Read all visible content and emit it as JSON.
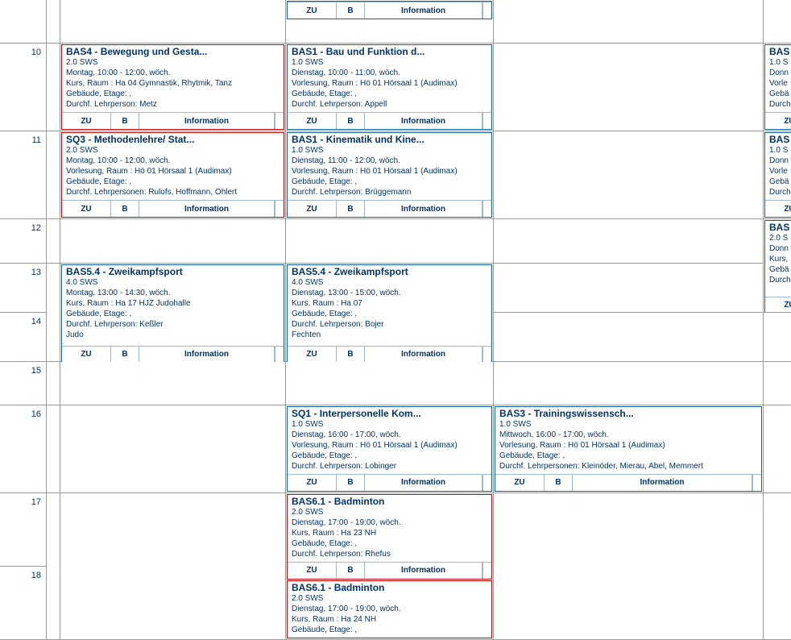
{
  "buttons": {
    "zu": "ZU",
    "b": "B",
    "info": "Information"
  },
  "hours": {
    "r9": "",
    "r10": "10",
    "r11": "11",
    "r12": "12",
    "r13": "13",
    "r14": "14",
    "r15": "15",
    "r16": "16",
    "r17": "17",
    "r18": "18"
  },
  "c_top_tue": {
    "has_header": false
  },
  "c10_mon": {
    "code": "BAS4",
    "title": "Bewegung und Gesta...",
    "sws": "2.0 SWS",
    "time": "Montag,  10:00 - 12:00, wöch.",
    "room": "Kurs, Raum : Ha 04 Gymnastik, Rhytmik, Tanz",
    "geb": "Gebäude, Etage: ,",
    "pers": "Durchf. Lehrperson: Metz",
    "red": true
  },
  "c10_tue": {
    "code": "BAS1",
    "title": "Bau und Funktion d...",
    "sws": "1.0 SWS",
    "time": "Dienstag,  10:00 - 11:00, wöch.",
    "room": "Vorlesung, Raum : Hö 01 Hörsaal 1 (Audimax)",
    "geb": "Gebäude, Etage: ,",
    "pers": "Durchf. Lehrperson: Appell",
    "red": false
  },
  "c10_thu": {
    "code": "BAS",
    "sws": "1.0 S",
    "time": "Donn",
    "room": "Vorle",
    "geb": "Gebä",
    "pers": "Durch",
    "red": false
  },
  "c11_mon": {
    "code": "SQ3",
    "title": "Methodenlehre/ Stat...",
    "sws": "2.0 SWS",
    "time": "Montag,  10:00 - 12:00, wöch.",
    "room": "Vorlesung, Raum : Hö 01 Hörsaal 1 (Audimax)",
    "geb": "Gebäude, Etage: ,",
    "pers": "Durchf. Lehrpersonen: Rulofs,  Hoffmann,  Ohlert",
    "red": true
  },
  "c11_tue": {
    "code": "BAS1",
    "title": "Kinematik und Kine...",
    "sws": "1.0 SWS",
    "time": "Dienstag,  11:00 - 12:00, wöch.",
    "room": "Vorlesung, Raum : Hö 01 Hörsaal 1 (Audimax)",
    "geb": "Gebäude, Etage: ,",
    "pers": "Durchf. Lehrperson: Brüggemann",
    "red": false
  },
  "c11_thu": {
    "code": "BAS",
    "sws": "1.0 S",
    "time": "Donn",
    "room": "Vorle",
    "geb": "Gebä",
    "pers": "Durch",
    "red": false
  },
  "c12_thu": {
    "code": "BAS",
    "sws": "2.0 S",
    "time": "Donn",
    "room": "Kurs,",
    "geb": "Gebä",
    "pers": "Durch",
    "red": false
  },
  "c13_mon": {
    "code": "BAS5.4",
    "title": "Zweikampfsport",
    "sws": "4.0 SWS",
    "time": "Montag,  13:00 - 14:30, wöch.",
    "room": "Kurs, Raum : Ha 17 HJZ Judohalle",
    "geb": "Gebäude, Etage: ,",
    "pers": "Durchf. Lehrperson: Keßler",
    "extra": "Judo",
    "red": false
  },
  "c13_tue": {
    "code": "BAS5.4",
    "title": "Zweikampfsport",
    "sws": "4.0 SWS",
    "time": "Dienstag,  13:00 - 15:00, wöch.",
    "room": "Kurs, Raum : Ha 07",
    "geb": "Gebäude, Etage: ,",
    "pers": "Durchf. Lehrperson: Bojer",
    "extra": "Fechten",
    "red": false
  },
  "c16_tue": {
    "code": "SQ1",
    "title": "Interpersonelle Kom...",
    "sws": "1.0 SWS",
    "time": "Dienstag,  16:00 - 17:00, wöch.",
    "room": "Vorlesung, Raum : Hö 01 Hörsaal 1 (Audimax)",
    "geb": "Gebäude, Etage: ,",
    "pers": "Durchf. Lehrperson: Lobinger",
    "red": false
  },
  "c16_wed": {
    "code": "BAS3",
    "title": "Trainingswissensch...",
    "sws": "1.0 SWS",
    "time": "Mittwoch,  16:00 - 17:00, wöch.",
    "room": "Vorlesung, Raum : Hö 01 Hörsaal 1 (Audimax)",
    "geb": "Gebäude, Etage: ,",
    "pers": "Durchf. Lehrpersonen: Kleinöder,  Mierau,  Abel,  Memmert",
    "red": false
  },
  "c17_tue_a": {
    "code": "BAS6.1",
    "title": "Badminton",
    "sws": "2.0 SWS",
    "time": "Dienstag,  17:00 - 19:00, wöch.",
    "room": "Kurs, Raum : Ha 23 NH",
    "geb": "Gebäude, Etage: ,",
    "pers": "Durchf. Lehrperson: Rhefus",
    "red": true
  },
  "c17_tue_b": {
    "code": "BAS6.1",
    "title": "Badminton",
    "sws": "2.0 SWS",
    "time": "Dienstag,  17:00 - 19:00, wöch.",
    "room": "Kurs, Raum : Ha 24 NH",
    "geb": "Gebäude, Etage: ,",
    "red": true
  }
}
